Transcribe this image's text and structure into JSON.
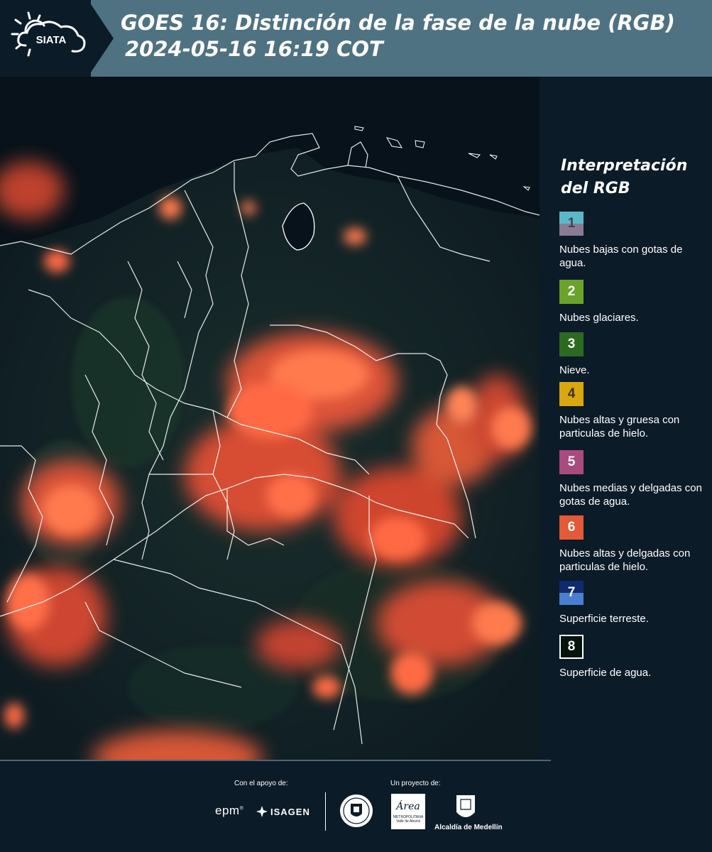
{
  "header": {
    "logo_text": "SIATA",
    "title_line1": "GOES 16: Distinción de la fase de la nube (RGB)",
    "title_line2": "2024-05-16 16:19 COT"
  },
  "legend": {
    "title_line1": "Interpretación",
    "title_line2": "del RGB",
    "items": [
      {
        "number": "1",
        "label": "Nubes bajas con gotas de agua.",
        "color_top": "#5ab9c9",
        "color_bottom": "#8a7a96",
        "text_color": "#3d4450"
      },
      {
        "number": "2",
        "label": "Nubes glaciares.",
        "color_top": "#6aa329",
        "color_bottom": "#6aa329",
        "text_color": "#ffffff"
      },
      {
        "number": "3",
        "label": "Nieve.",
        "color_top": "#2d6a21",
        "color_bottom": "#2d6a21",
        "text_color": "#ffffff"
      },
      {
        "number": "4",
        "label": "Nubes altas y gruesa con particulas de hielo.",
        "color_top": "#d9a710",
        "color_bottom": "#d9a710",
        "text_color": "#3d3010"
      },
      {
        "number": "5",
        "label": "Nubes medias y delgadas con gotas de agua.",
        "color_top": "#a94b7e",
        "color_bottom": "#a94b7e",
        "text_color": "#ffffff"
      },
      {
        "number": "6",
        "label": "Nubes altas y delgadas con particulas de hielo.",
        "color_top": "#e25a37",
        "color_bottom": "#e25a37",
        "text_color": "#ffffff"
      },
      {
        "number": "7",
        "label": "Superficie terreste.",
        "color_top": "#0f2a6e",
        "color_bottom": "#4a7fd0",
        "text_color": "#ffffff"
      },
      {
        "number": "8",
        "label": "Superficie de agua.",
        "color_top": "#07130d",
        "color_bottom": "#07130d",
        "text_color": "#ffffff"
      }
    ]
  },
  "footer": {
    "support_label": "Con el apoyo de:",
    "project_label": "Un proyecto de:",
    "sponsor_epm": "epm",
    "sponsor_isagen": "ISAGEN",
    "partner_amva_line1": "Área",
    "partner_amva_line2": "METROPOLITANA",
    "partner_amva_line3": "Valle de Aburrá",
    "partner_alcaldia": "Alcaldía de Medellín"
  },
  "colors": {
    "background": "#0c1b28",
    "header_band": "#4e7281",
    "cloud_ice": "#ff6a3d",
    "map_dark": "#0a1620"
  }
}
